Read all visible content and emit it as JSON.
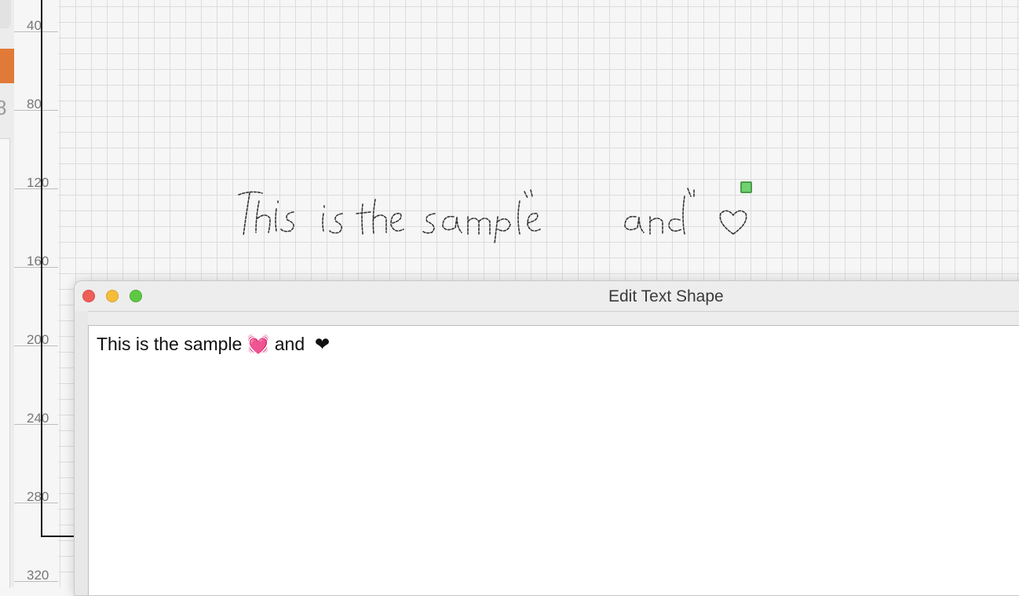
{
  "ruler": {
    "labels": [
      "40",
      "80",
      "120",
      "160",
      "200",
      "240",
      "280",
      "320"
    ]
  },
  "sidebar": {
    "partial_digit": "8"
  },
  "canvas": {
    "shape_text": "This is the sample 💓 and ❤"
  },
  "dialog": {
    "title": "Edit Text Shape",
    "editor_text": "This is the sample 💓 and  ❤"
  },
  "colors": {
    "accent_orange": "#e07a36",
    "selection_handle": "#6fd26f",
    "close": "#ee5f57",
    "minimize": "#f6bd3b",
    "maximize": "#5ec844"
  }
}
